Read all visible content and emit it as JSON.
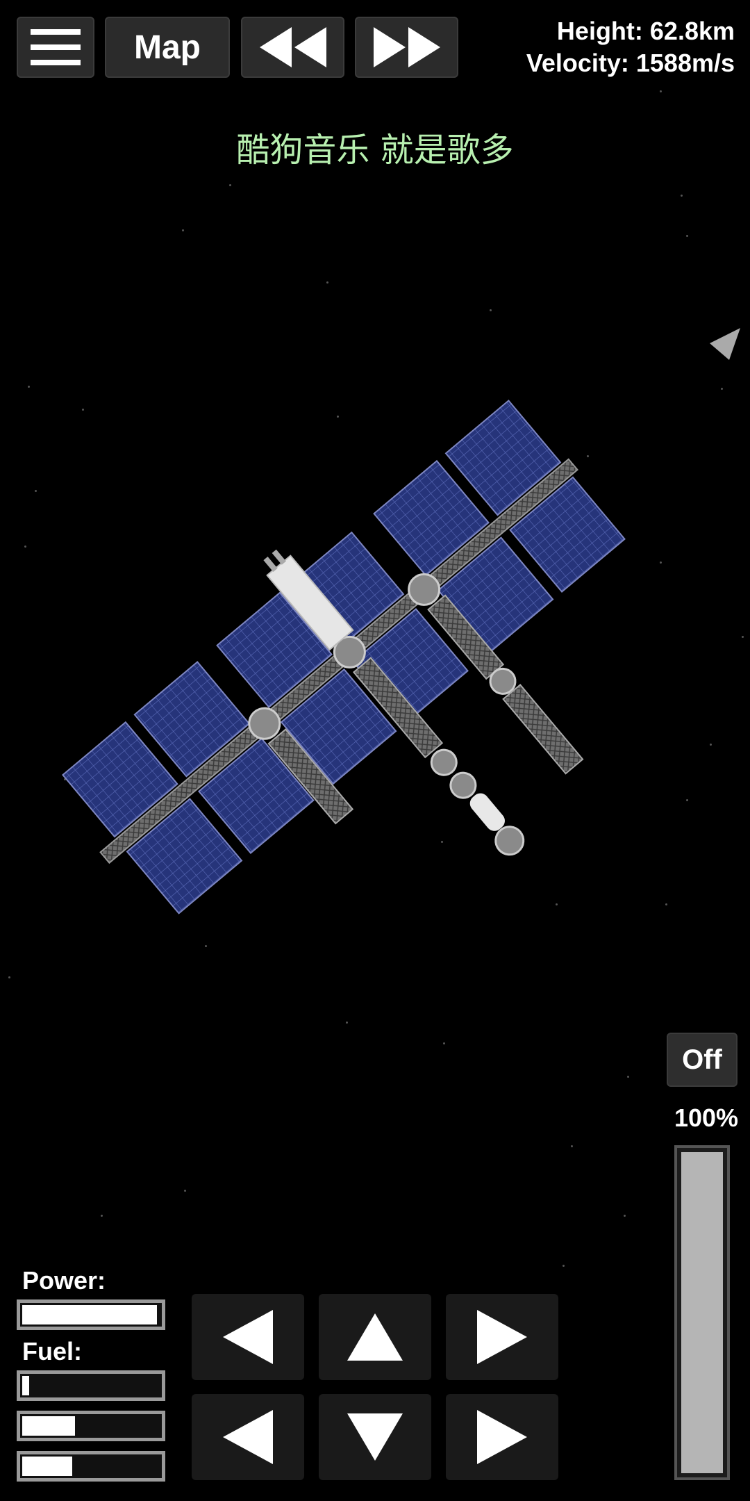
{
  "toolbar": {
    "map_label": "Map",
    "menu_icon": "hamburger-menu-icon",
    "rewind_icon": "rewind-icon",
    "fast_forward_icon": "fast-forward-icon"
  },
  "telemetry": {
    "height": "Height: 62.8km",
    "velocity": "Velocity: 1588m/s"
  },
  "banner_text": "酷狗音乐  就是歌多",
  "throttle": {
    "toggle_label": "Off",
    "percent_label": "100%",
    "level": 1.0
  },
  "resources": {
    "power_label": "Power:",
    "power_level": 0.98,
    "fuel_label": "Fuel:",
    "fuel_levels": [
      0.08,
      0.4,
      0.38
    ]
  },
  "controls": {
    "icons": [
      "rotate-left-arrow-icon",
      "thrust-up-arrow-icon",
      "rotate-right-arrow-icon",
      "move-left-arrow-icon",
      "thrust-down-arrow-icon",
      "move-right-arrow-icon"
    ]
  },
  "colors": {
    "background": "#000000",
    "button": "#2b2b2b",
    "banner_text": "#b8f0b0",
    "solar_panel": "#26347a"
  }
}
